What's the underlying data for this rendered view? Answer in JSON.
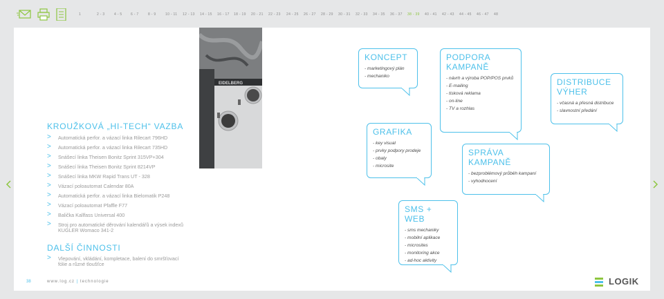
{
  "toolbar": {
    "icons": [
      "mail-icon",
      "printer-icon",
      "document-icon"
    ],
    "pages": [
      {
        "label": "1",
        "active": false
      },
      {
        "label": "2 - 3",
        "active": false
      },
      {
        "label": "4 - 5",
        "active": false
      },
      {
        "label": "6 - 7",
        "active": false
      },
      {
        "label": "8 - 9",
        "active": false
      },
      {
        "label": "10 - 11",
        "active": false
      },
      {
        "label": "12 - 13",
        "active": false
      },
      {
        "label": "14 - 15",
        "active": false
      },
      {
        "label": "16 - 17",
        "active": false
      },
      {
        "label": "18 - 19",
        "active": false
      },
      {
        "label": "20 - 21",
        "active": false
      },
      {
        "label": "22 - 23",
        "active": false
      },
      {
        "label": "24 - 25",
        "active": false
      },
      {
        "label": "26 - 27",
        "active": false
      },
      {
        "label": "28 - 29",
        "active": false
      },
      {
        "label": "30 - 31",
        "active": false
      },
      {
        "label": "32 - 33",
        "active": false
      },
      {
        "label": "34 - 35",
        "active": false
      },
      {
        "label": "36 - 37",
        "active": false
      },
      {
        "label": "38 - 39",
        "active": true
      },
      {
        "label": "40 - 41",
        "active": false
      },
      {
        "label": "42 - 43",
        "active": false
      },
      {
        "label": "44 - 45",
        "active": false
      },
      {
        "label": "46 - 47",
        "active": false
      },
      {
        "label": "48",
        "active": false
      }
    ]
  },
  "colors": {
    "accent": "#4cc0ea",
    "active_page": "#8dc63f"
  },
  "photo": {
    "brand_text": "EIDELBERG"
  },
  "binding": {
    "title": "KROUŽKOVÁ „HI-TECH“ VAZBA",
    "items": [
      "Automatická perfor. a vázací linka Rilecart 796HD",
      "Automatická perfor. a vázací linka Rilecart 735HD",
      "Snášecí linka Theisen Bonitz Sprint 315VP+304",
      "Snášecí linka Theisen Bonitz Sprint 8214VP",
      "Snášecí linka MKW Rapid Trans UT - 328",
      "Vázací poloautomat Calendar 80A",
      "Automatická perfor. a vázací linka Bielomatik P248",
      "Vázací poloautomat Pfaffle F77",
      "Balička Kallfass Universal 400",
      "Stroj pro automatické děrování kalendářů a výsek indexů KUGLER Womaco 341-2"
    ]
  },
  "other": {
    "title": "DALŠÍ ČINNOSTI",
    "items": [
      "Vlepování, vkládání, kompletace, balení do smršťovací fólie a různé tloušťce"
    ]
  },
  "bubbles": {
    "koncept": {
      "title": "KONCEPT",
      "lines": [
        "- marketingový plán",
        "- mechaniko"
      ]
    },
    "podpora": {
      "title": "PODPORA KAMPANĚ",
      "lines": [
        "- návrh a výroba POP/POS prvků",
        "- E-mailing",
        "- tisková reklama",
        "- on-line",
        "- TV a rozhlas"
      ]
    },
    "distribuce": {
      "title": "DISTRIBUCE VÝHER",
      "lines": [
        "- včasná a přesná distribuce",
        "- slavnostní předání"
      ]
    },
    "grafika": {
      "title": "GRAFIKA",
      "lines": [
        "- key visual",
        "- prvky podpory prodeje",
        "- obaly",
        "- microsite"
      ]
    },
    "sprava": {
      "title": "SPRÁVA KAMPANĚ",
      "lines": [
        "- bezproblémový průběh kampaní",
        "- vyhodnocení"
      ]
    },
    "sms": {
      "title": "SMS + WEB",
      "lines": [
        "- sms mechaniky",
        "- mobilní aplikace",
        "- microsites",
        "- monitoring akce",
        "- ad-hoc aktivity"
      ]
    }
  },
  "footer": {
    "page_number": "38",
    "url": "www.log.cz",
    "separator": " | ",
    "section": "technologie"
  },
  "logo": {
    "text": "LOGIK"
  }
}
